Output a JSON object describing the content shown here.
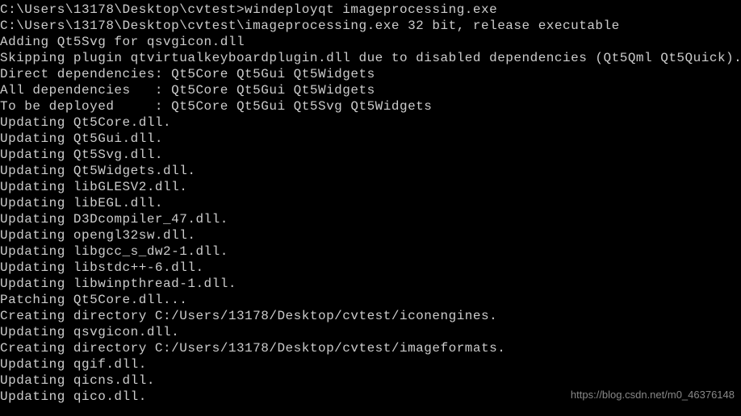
{
  "terminal": {
    "lines": [
      "C:\\Users\\13178\\Desktop\\cvtest>windeployqt imageprocessing.exe",
      "C:\\Users\\13178\\Desktop\\cvtest\\imageprocessing.exe 32 bit, release executable",
      "Adding Qt5Svg for qsvgicon.dll",
      "Skipping plugin qtvirtualkeyboardplugin.dll due to disabled dependencies (Qt5Qml Qt5Quick).",
      "Direct dependencies: Qt5Core Qt5Gui Qt5Widgets",
      "All dependencies   : Qt5Core Qt5Gui Qt5Widgets",
      "To be deployed     : Qt5Core Qt5Gui Qt5Svg Qt5Widgets",
      "Updating Qt5Core.dll.",
      "Updating Qt5Gui.dll.",
      "Updating Qt5Svg.dll.",
      "Updating Qt5Widgets.dll.",
      "Updating libGLESV2.dll.",
      "Updating libEGL.dll.",
      "Updating D3Dcompiler_47.dll.",
      "Updating opengl32sw.dll.",
      "Updating libgcc_s_dw2-1.dll.",
      "Updating libstdc++-6.dll.",
      "Updating libwinpthread-1.dll.",
      "Patching Qt5Core.dll...",
      "Creating directory C:/Users/13178/Desktop/cvtest/iconengines.",
      "Updating qsvgicon.dll.",
      "Creating directory C:/Users/13178/Desktop/cvtest/imageformats.",
      "Updating qgif.dll.",
      "Updating qicns.dll.",
      "Updating qico.dll."
    ]
  },
  "watermark": {
    "text": "https://blog.csdn.net/m0_46376148"
  }
}
